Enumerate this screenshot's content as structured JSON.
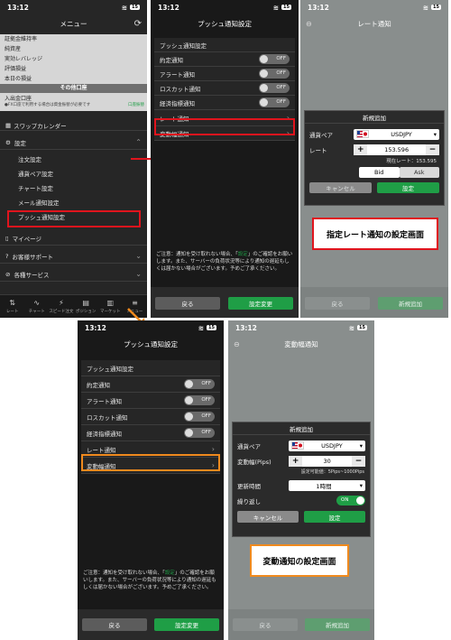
{
  "status": {
    "time": "13:12",
    "battery": "15"
  },
  "screen_menu": {
    "title": "メニュー",
    "stats": [
      "証拠金維持率",
      "純資産",
      "実効レバレッジ",
      "評価損益",
      "本日の損益"
    ],
    "other_header": "その他口座",
    "deposit": "入出金口座",
    "deposit_note": "●FX口座で利用する場合は資金振替が必要です",
    "deposit_badge": "口座振替",
    "calendar": "スワップカレンダー",
    "settings": "設定",
    "settings_items": [
      "注文設定",
      "通貨ペア設定",
      "チャート設定",
      "メール通知設定",
      "プッシュ通知設定"
    ],
    "mypage": "マイページ",
    "support": "お客様サポート",
    "services": "各種サービス",
    "tabs": [
      "レート",
      "チャート",
      "スピード注文",
      "ポジション",
      "マーケット",
      "メニュー"
    ]
  },
  "screen_push": {
    "title": "プッシュ通知設定",
    "section": "プッシュ通知設定",
    "rows": [
      {
        "label": "約定通知",
        "state": "OFF"
      },
      {
        "label": "アラート通知",
        "state": "OFF"
      },
      {
        "label": "ロスカット通知",
        "state": "OFF"
      },
      {
        "label": "経済指標通知",
        "state": "OFF"
      }
    ],
    "rate_notice": "レート通知",
    "range_notice": "変動幅通知",
    "note": "ご注意：通知を受け取れない場合、「設定」のご確認をお願いします。また、サーバーの負荷状況等により通知の遅延もしくは届かない場合がございます。予めご了承ください。",
    "note_highlight": "設定",
    "back": "戻る",
    "save": "設定変更"
  },
  "screen_rate": {
    "title": "レート通知",
    "dialog_title": "新規追加",
    "pair_label": "通貨ペア",
    "pair_value": "USDJPY",
    "rate_label": "レート",
    "rate_value": "153.596",
    "current_rate": "現在レート：153.595",
    "bid": "Bid",
    "ask": "Ask",
    "cancel": "キャンセル",
    "ok": "設定",
    "caption": "指定レート通知の設定画面",
    "back": "戻る",
    "add": "新規追加"
  },
  "screen_range": {
    "title": "変動幅通知",
    "dialog_title": "新規追加",
    "pair_label": "通貨ペア",
    "pair_value": "USDJPY",
    "range_label": "変動幅(Pips)",
    "range_value": "30",
    "range_hint": "設定可能値：5Pips~1000Pips",
    "interval_label": "更新時間",
    "interval_value": "1時間",
    "repeat_label": "繰り返し",
    "repeat_state": "ON",
    "cancel": "キャンセル",
    "ok": "設定",
    "caption": "変動通知の設定画面",
    "back": "戻る",
    "add": "新規追加"
  },
  "colors": {
    "red": "#e0141d",
    "orange": "#f08a1e",
    "green": "#1f9e46"
  }
}
